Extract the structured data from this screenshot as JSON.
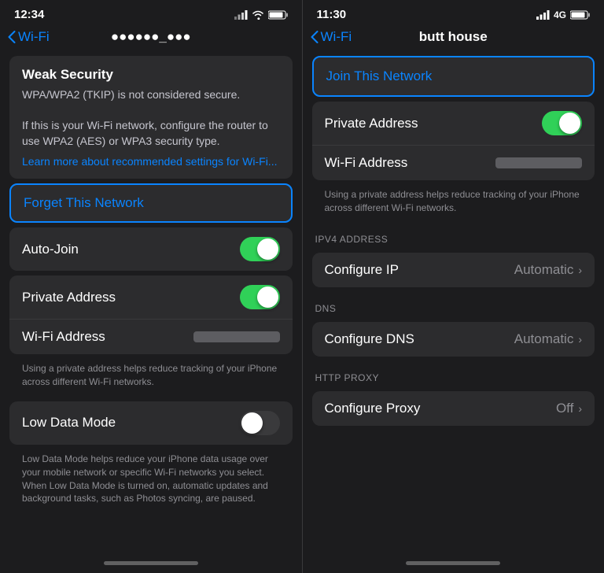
{
  "left": {
    "status": {
      "time": "12:34",
      "signal": "signal",
      "wifi": "wifi",
      "battery": "battery"
    },
    "nav": {
      "back_label": "Wi-Fi",
      "network_name": "●●●●●●_●●●"
    },
    "weak_security": {
      "title": "Weak Security",
      "body": "WPA/WPA2 (TKIP) is not considered secure.\n\nIf this is your Wi-Fi network, configure the router to use WPA2 (AES) or WPA3 security type.",
      "learn_more": "Learn more about recommended settings for Wi-Fi..."
    },
    "forget": {
      "label": "Forget This Network"
    },
    "rows": {
      "auto_join": "Auto-Join",
      "private_address": "Private Address",
      "wifi_address": "Wi-Fi Address",
      "addr_desc": "Using a private address helps reduce tracking of your iPhone across different Wi-Fi networks.",
      "low_data_mode": "Low Data Mode",
      "low_data_desc": "Low Data Mode helps reduce your iPhone data usage over your mobile network or specific Wi-Fi networks you select. When Low Data Mode is turned on, automatic updates and background tasks, such as Photos syncing, are paused."
    }
  },
  "right": {
    "status": {
      "time": "11:30",
      "signal": "signal",
      "network": "4G",
      "battery": "battery"
    },
    "nav": {
      "back_label": "Wi-Fi",
      "title": "butt house"
    },
    "join": {
      "label": "Join This Network"
    },
    "rows": {
      "private_address": "Private Address",
      "wifi_address": "Wi-Fi Address",
      "addr_desc": "Using a private address helps reduce tracking of your iPhone across different Wi-Fi networks."
    },
    "ipv4_section": "IPV4 ADDRESS",
    "configure_ip": {
      "label": "Configure IP",
      "value": "Automatic"
    },
    "dns_section": "DNS",
    "configure_dns": {
      "label": "Configure DNS",
      "value": "Automatic"
    },
    "http_proxy_section": "HTTP PROXY",
    "configure_proxy": {
      "label": "Configure Proxy",
      "value": "Off"
    }
  }
}
